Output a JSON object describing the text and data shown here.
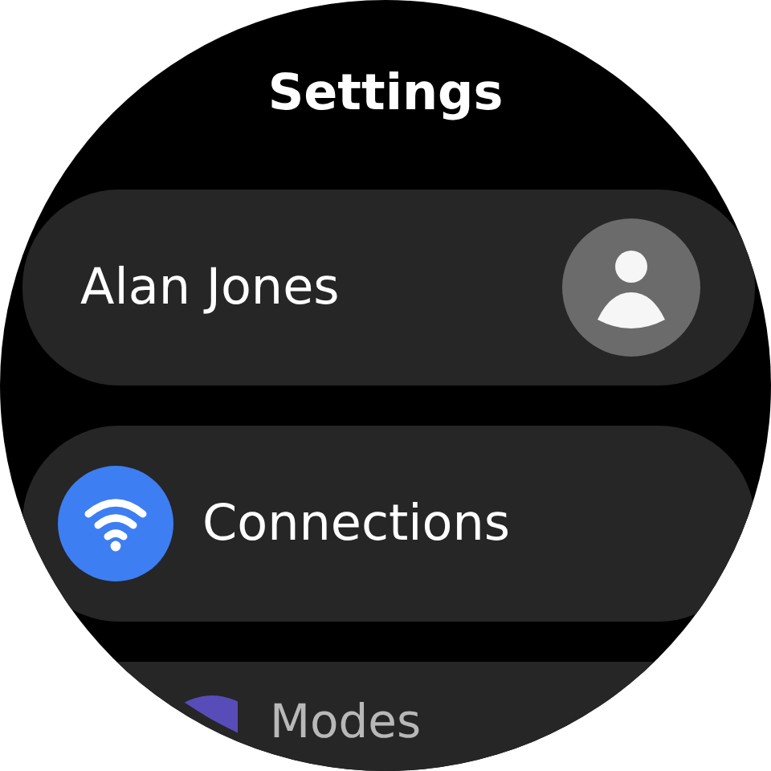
{
  "title": "Settings",
  "items": [
    {
      "kind": "profile",
      "label": "Alan Jones"
    },
    {
      "kind": "wifi",
      "label": "Connections",
      "color": "#3d7ef2"
    },
    {
      "kind": "modes",
      "label": "Modes",
      "color": "#584cb8"
    }
  ]
}
